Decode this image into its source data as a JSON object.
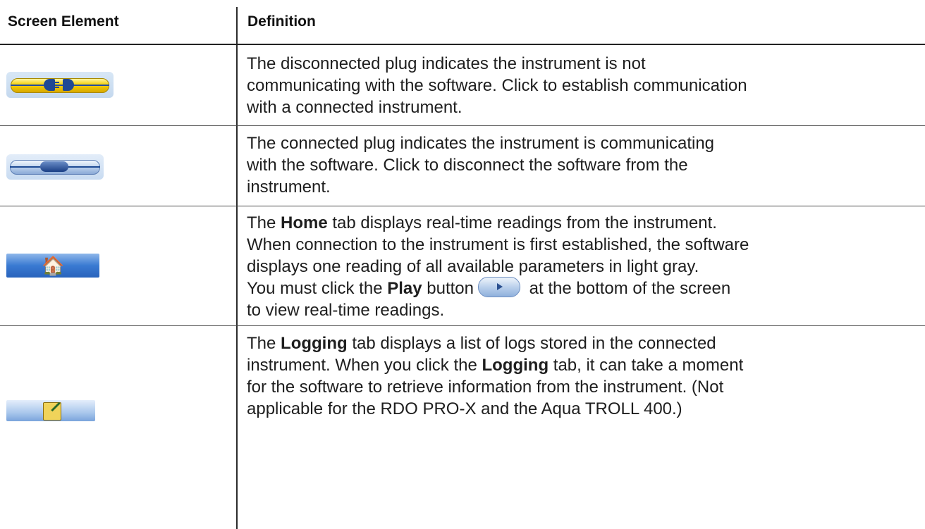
{
  "table": {
    "headers": [
      "Screen Element",
      "Definition"
    ],
    "rows": [
      {
        "icon": "disconnected-plug-icon",
        "definition": {
          "lines": [
            "The disconnected plug indicates the instrument is not",
            "communicating with the software. Click to establish communication",
            "with a connected instrument."
          ]
        }
      },
      {
        "icon": "connected-plug-icon",
        "definition": {
          "lines": [
            "The connected plug indicates the instrument is communicating",
            "with the software. Click to disconnect the software from the",
            "instrument."
          ]
        }
      },
      {
        "icon": "home-tab-icon",
        "definition": {
          "line1_pre": "The ",
          "line1_bold": "Home",
          "line1_post": " tab displays real-time readings from the instrument.",
          "line2": "When connection to the instrument is first established, the software",
          "line3": "displays one reading of all available parameters in light gray.",
          "line4_pre": "You must click the ",
          "line4_bold": "Play",
          "line4_mid": " button",
          "line4_post": " at the bottom of the screen",
          "line5": "to view real-time readings.",
          "inline_icon": "play-button-icon"
        }
      },
      {
        "icon": "logging-tab-icon",
        "definition": {
          "line1_pre": "The ",
          "line1_bold": "Logging",
          "line1_post": " tab displays a list of logs stored in the connected",
          "line2_pre": "instrument. When you click the ",
          "line2_bold": "Logging",
          "line2_post": " tab, it can take a moment",
          "line3": "for the software to retrieve information from the instrument. (Not",
          "line4": "applicable for the RDO PRO-X and the Aqua TROLL 400.)"
        }
      }
    ]
  },
  "colors": {
    "rule": "#4a4a4a",
    "text": "#1e1e1e",
    "accent_blue": "#2863bc",
    "accent_yellow": "#f5d000"
  }
}
